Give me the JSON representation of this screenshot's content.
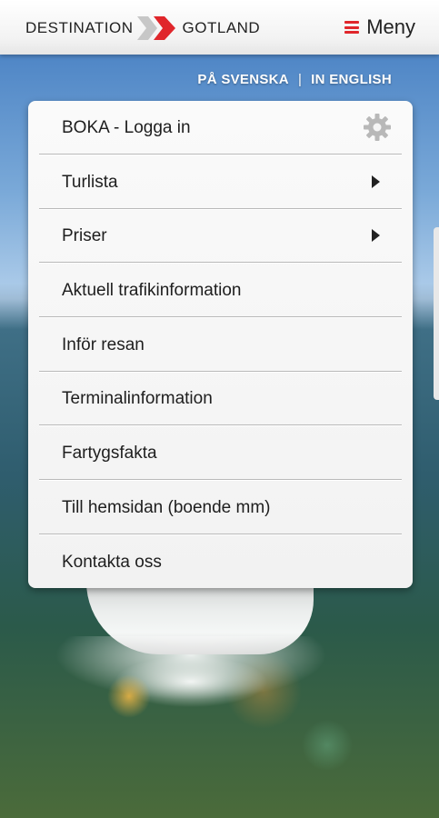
{
  "brand": {
    "left_word": "DESTINATION",
    "right_word": "GOTLAND",
    "chevron_colors": [
      "#c7c7c7",
      "#e0262b"
    ]
  },
  "header": {
    "menu_label": "Meny",
    "menu_icon": "hamburger-icon",
    "accent_color": "#e0262b"
  },
  "language": {
    "swedish": "PÅ SVENSKA",
    "separator": "|",
    "english": "IN ENGLISH"
  },
  "menu": {
    "items": [
      {
        "label": "BOKA - Logga in",
        "icon": "gear-icon"
      },
      {
        "label": "Turlista",
        "icon": "arrow-right-icon"
      },
      {
        "label": "Priser",
        "icon": "arrow-right-icon"
      },
      {
        "label": "Aktuell trafikinformation"
      },
      {
        "label": "Inför resan"
      },
      {
        "label": "Terminalinformation"
      },
      {
        "label": "Fartygsfakta"
      },
      {
        "label": "Till hemsidan (boende mm)"
      },
      {
        "label": "Kontakta oss"
      }
    ]
  }
}
